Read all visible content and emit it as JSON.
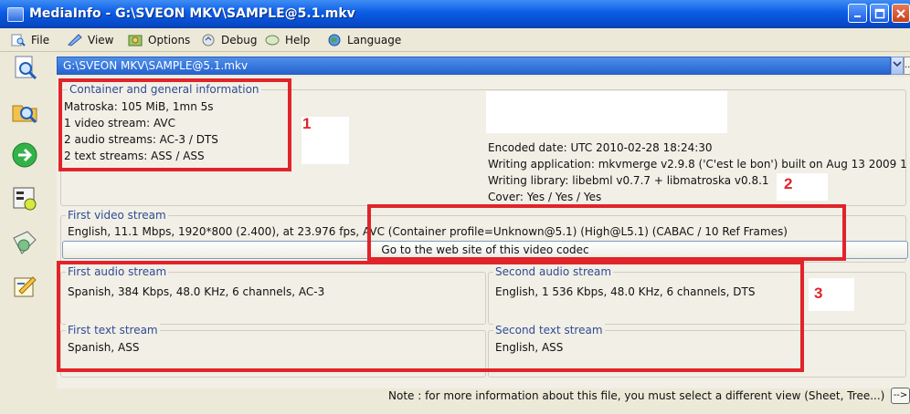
{
  "window": {
    "title": "MediaInfo - G:\\SVEON MKV\\SAMPLE@5.1.mkv"
  },
  "menu": [
    {
      "label": "File",
      "icon": "file-search-icon"
    },
    {
      "label": "View",
      "icon": "view-icon"
    },
    {
      "label": "Options",
      "icon": "options-icon"
    },
    {
      "label": "Debug",
      "icon": "debug-icon"
    },
    {
      "label": "Help",
      "icon": "help-icon"
    },
    {
      "label": "Language",
      "icon": "language-globe-icon"
    }
  ],
  "toolbar_icons": [
    "open-file-icon",
    "open-folder-icon",
    "next-arrow-icon",
    "preferences-icon",
    "export-icon",
    "about-icon"
  ],
  "path_combo": {
    "value": "G:\\SVEON MKV\\SAMPLE@5.1.mkv",
    "more_label": "..."
  },
  "general": {
    "legend": "Container and general information",
    "lines": [
      "Matroska: 105 MiB, 1mn 5s",
      "1 video stream: AVC",
      "2 audio streams: AC-3 / DTS",
      "2 text streams: ASS / ASS"
    ],
    "meta_lines": [
      "Encoded date: UTC 2010-02-28 18:24:30",
      "Writing application: mkvmerge v2.9.8 ('C'est le bon') built on Aug 13 2009 1",
      "Writing library: libebml v0.7.7 + libmatroska v0.8.1",
      "Cover: Yes / Yes / Yes"
    ]
  },
  "video": {
    "legend": "First video stream",
    "line": "English, 11.1 Mbps, 1920*800 (2.400), at 23.976 fps, AVC (Container profile=Unknown@5.1) (High@L5.1) (CABAC / 10 Ref Frames)",
    "web_button": "Go to the web site of this video codec"
  },
  "audio1": {
    "legend": "First audio stream",
    "line": "Spanish, 384 Kbps, 48.0 KHz, 6 channels, AC-3"
  },
  "audio2": {
    "legend": "Second audio stream",
    "line": "English, 1 536 Kbps, 48.0 KHz, 6 channels, DTS"
  },
  "text1": {
    "legend": "First text stream",
    "line": "Spanish, ASS"
  },
  "text2": {
    "legend": "Second text stream",
    "line": "English, ASS"
  },
  "note": {
    "text": "Note : for more information about this file, you must select a different view (Sheet, Tree...)",
    "button": "-->"
  },
  "annotations": [
    "1",
    "2",
    "3"
  ],
  "colors": {
    "annotation_red": "#e0242a",
    "title_blue": "#0a5ce6",
    "legend_blue": "#2f4b94"
  }
}
